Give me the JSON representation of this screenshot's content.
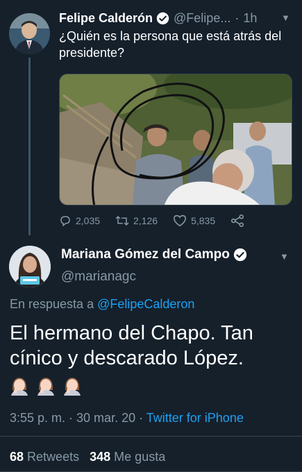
{
  "parent_tweet": {
    "display_name": "Felipe Calderón",
    "handle": "@Felipe...",
    "separator": "·",
    "time": "1h",
    "text": "¿Quién es la persona que está atrás del presidente?",
    "actions": {
      "replies": "2,035",
      "retweets": "2,126",
      "likes": "5,835"
    }
  },
  "reply_tweet": {
    "display_name": "Mariana Gómez del Campo",
    "handle": "@marianagc",
    "reply_prefix": "En respuesta a",
    "reply_to": "@FelipeCalderon",
    "text": "El hermano del Chapo. Tan cínico y descarado López.",
    "timestamp": "3:55 p. m. · 30 mar. 20 ·",
    "source": "Twitter for iPhone",
    "retweet_count": "68",
    "retweet_label": "Retweets",
    "like_count": "348",
    "like_label": "Me gusta",
    "emoji": [
      "woman-facepalming",
      "woman-facepalming",
      "woman-facepalming"
    ]
  },
  "colors": {
    "background": "#15202b",
    "primary_text": "#ffffff",
    "secondary_text": "#8899a6",
    "accent": "#1da1f2",
    "divider": "#38444d"
  }
}
